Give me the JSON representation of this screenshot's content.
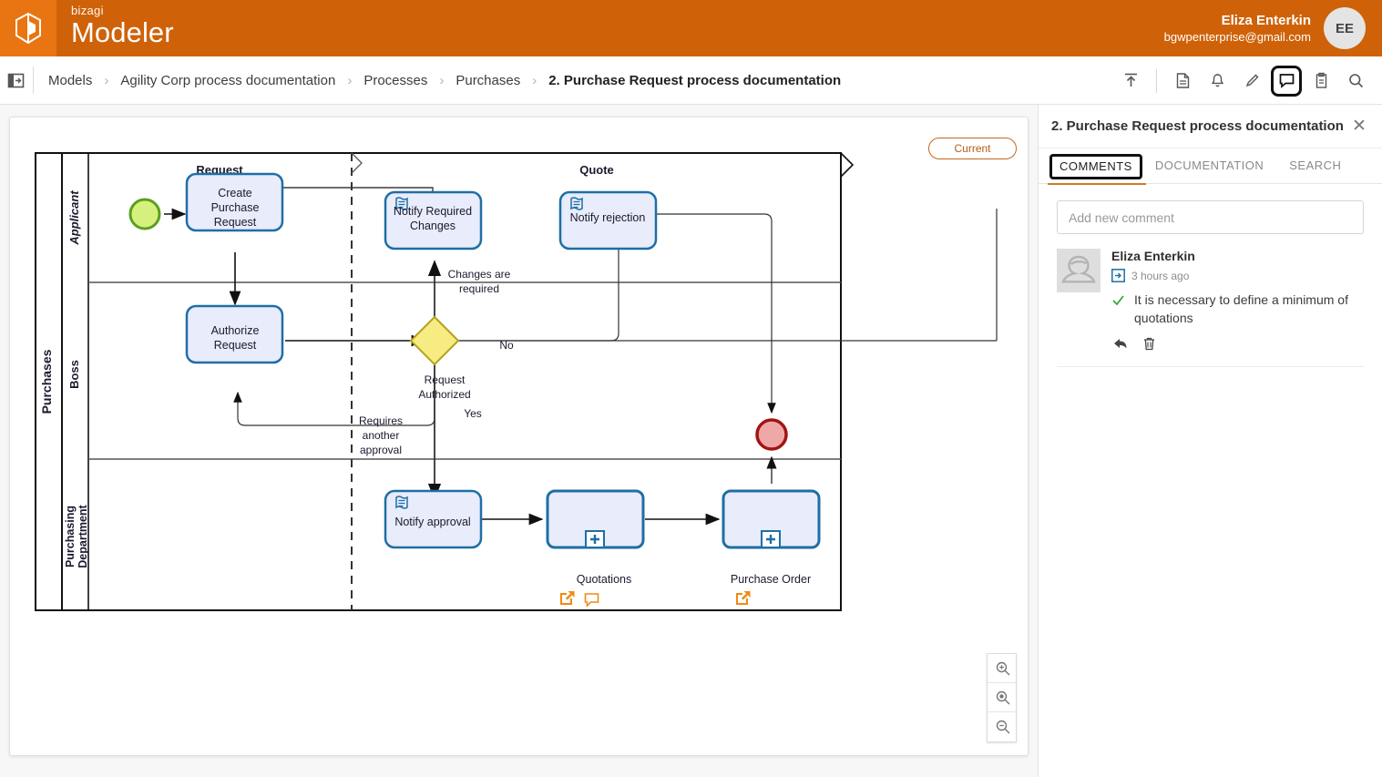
{
  "app": {
    "brand_small": "bizagi",
    "brand_big": "Modeler",
    "logo_icon": "bizagi-cube-icon"
  },
  "user": {
    "name": "Eliza Enterkin",
    "email": "bgwpenterprise@gmail.com",
    "initials": "EE",
    "avatar_icon": "user-avatar"
  },
  "breadcrumb": {
    "panel_toggle_icon": "panel-toggle-icon",
    "separator": "›",
    "items": [
      {
        "label": "Models",
        "active": false
      },
      {
        "label": "Agility Corp process documentation",
        "active": false
      },
      {
        "label": "Processes",
        "active": false
      },
      {
        "label": "Purchases",
        "active": false
      },
      {
        "label": "2. Purchase Request process documentation",
        "active": true
      }
    ]
  },
  "toolbar": {
    "icons": [
      {
        "name": "export-upload-icon",
        "label": "Export"
      },
      {
        "name": "document-pages-icon",
        "label": "Pages"
      },
      {
        "name": "bell-notification-icon",
        "label": "Notifications"
      },
      {
        "name": "pencil-edit-icon",
        "label": "Edit"
      },
      {
        "name": "comment-bubble-icon",
        "label": "Comments",
        "selected": true
      },
      {
        "name": "clipboard-icon",
        "label": "Clipboard"
      },
      {
        "name": "search-icon",
        "label": "Search"
      }
    ]
  },
  "canvas": {
    "badge_current": "Current",
    "zoom_buttons": [
      {
        "name": "zoom-in-button",
        "icon": "magnifier-plus-icon"
      },
      {
        "name": "zoom-reset-button",
        "icon": "magnifier-dot-icon"
      },
      {
        "name": "zoom-out-button",
        "icon": "magnifier-minus-icon"
      }
    ]
  },
  "diagram": {
    "type": "bpmn",
    "pool": "Purchases",
    "lanes": [
      "Applicant",
      "Boss",
      "Purchasing Department"
    ],
    "phases": [
      "Request",
      "Quote"
    ],
    "events": [
      {
        "id": "start",
        "type": "start-event",
        "lane": "Applicant",
        "fill": "#d6f07e",
        "stroke": "#5aa01e"
      },
      {
        "id": "end",
        "type": "end-event",
        "lane": "Boss",
        "fill": "#efa8a8",
        "stroke": "#a31414"
      }
    ],
    "tasks": [
      {
        "id": "create-purchase-request",
        "label": "Create Purchase Request",
        "lane": "Applicant",
        "task_type": "user"
      },
      {
        "id": "notify-required-changes",
        "label": "Notify Required Changes",
        "lane": "Applicant",
        "task_type": "script"
      },
      {
        "id": "notify-rejection",
        "label": "Notify rejection",
        "lane": "Applicant",
        "task_type": "script"
      },
      {
        "id": "authorize-request",
        "label": "Authorize Request",
        "lane": "Boss",
        "task_type": "user"
      },
      {
        "id": "notify-approval",
        "label": "Notify approval",
        "lane": "Purchasing Department",
        "task_type": "script"
      },
      {
        "id": "quotations",
        "label": "Quotations",
        "lane": "Purchasing Department",
        "task_type": "collapsed-subprocess",
        "markers": [
          "external-link-icon",
          "comment-bubble-icon"
        ]
      },
      {
        "id": "purchase-order",
        "label": "Purchase Order",
        "lane": "Purchasing Department",
        "task_type": "collapsed-subprocess",
        "markers": [
          "external-link-icon"
        ]
      }
    ],
    "gateways": [
      {
        "id": "request-authorized",
        "label": "Request Authorized",
        "type": "exclusive",
        "fill": "#f6ec81",
        "stroke": "#b3a21f"
      }
    ],
    "flow_labels": [
      "Changes are required",
      "No",
      "Yes",
      "Requires another approval"
    ]
  },
  "side_panel": {
    "title": "2. Purchase Request process documentation",
    "close_icon": "close-icon",
    "tabs": [
      {
        "label": "COMMENTS",
        "active": true
      },
      {
        "label": "DOCUMENTATION",
        "active": false
      },
      {
        "label": "SEARCH",
        "active": false
      }
    ],
    "new_comment_placeholder": "Add new comment",
    "comments": [
      {
        "author": "Eliza Enterkin",
        "time": "3 hours ago",
        "source_icon": "link-in-icon",
        "status_icon": "check-icon",
        "text": "It is necessary to define a minimum of quotations",
        "actions": [
          {
            "name": "reply-button",
            "icon": "reply-arrow-icon"
          },
          {
            "name": "delete-button",
            "icon": "trash-icon"
          }
        ]
      }
    ]
  },
  "colors": {
    "brand_orange": "#cf6208",
    "logo_orange": "#e87511",
    "task_fill": "#e8ecfb",
    "task_stroke": "#1f6ea5",
    "marker_orange": "#ef8b12",
    "accent": "#d07b22"
  }
}
